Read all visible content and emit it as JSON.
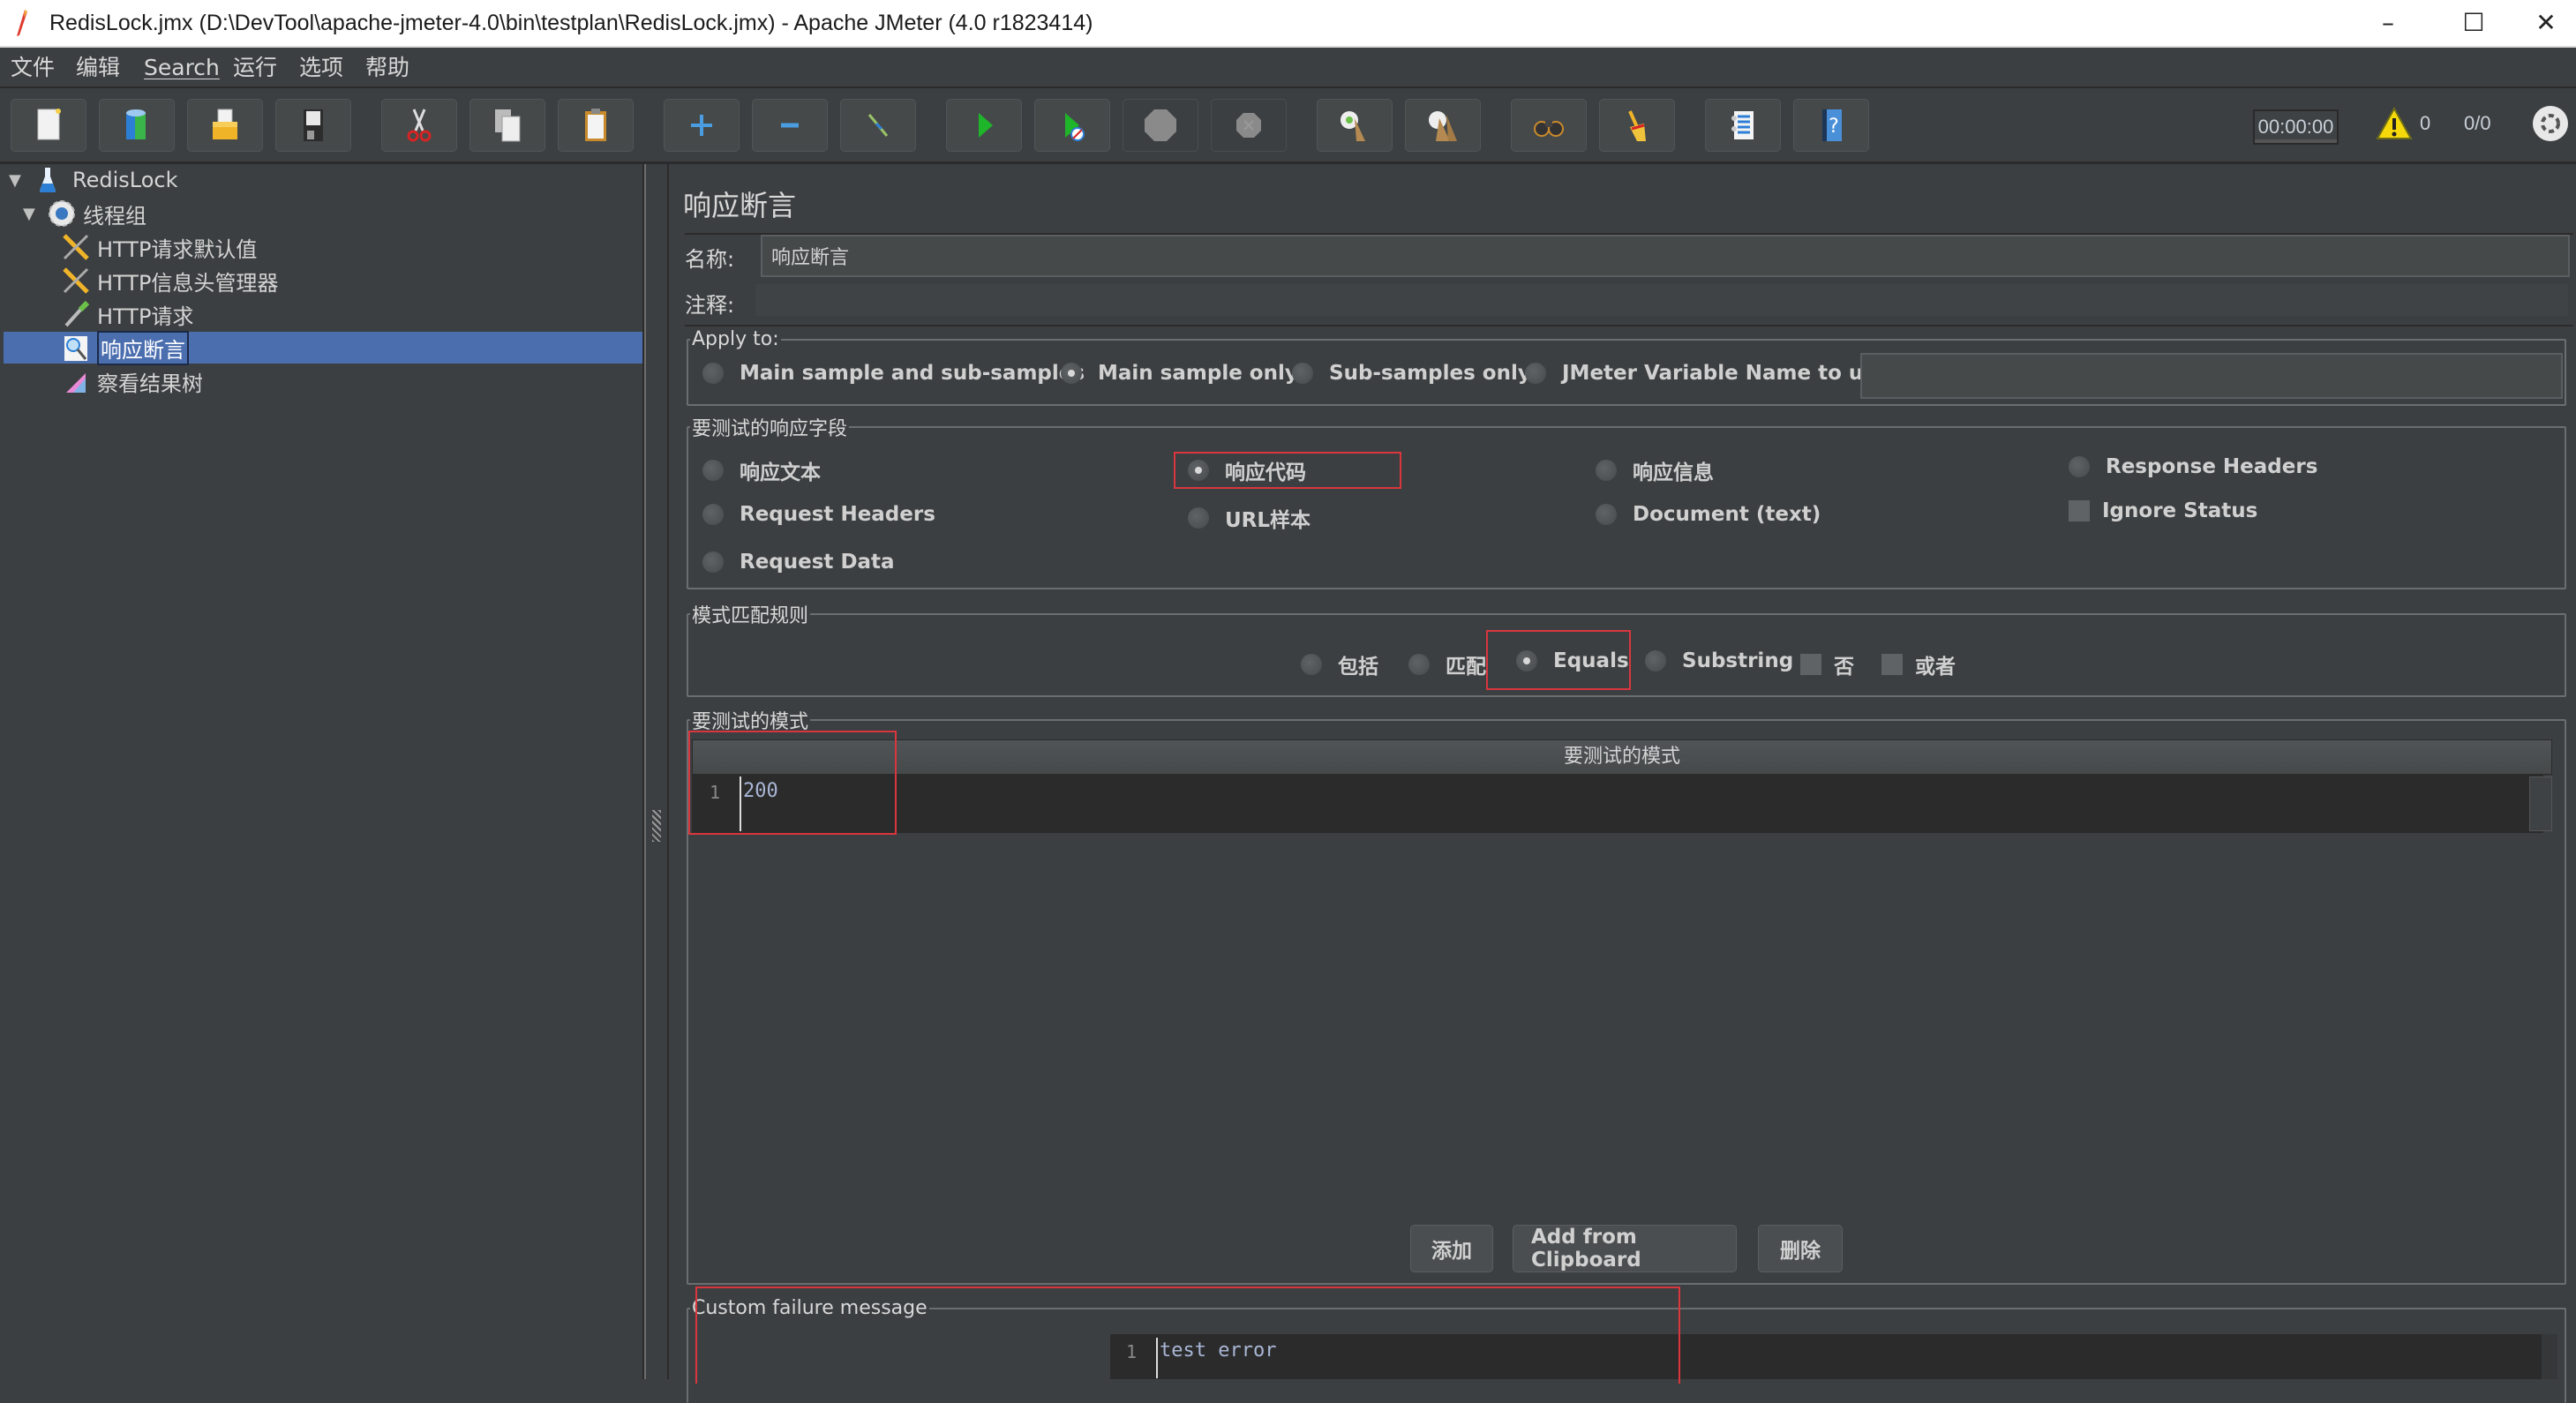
{
  "window": {
    "title": "RedisLock.jmx (D:\\DevTool\\apache-jmeter-4.0\\bin\\testplan\\RedisLock.jmx) - Apache JMeter (4.0 r1823414)",
    "minimize": "–",
    "maximize": "☐",
    "close": "✕"
  },
  "menu": [
    "文件",
    "编辑",
    "Search",
    "运行",
    "选项",
    "帮助"
  ],
  "toolbar": {
    "buttons": [
      {
        "icon": "new-icon"
      },
      {
        "icon": "templates-icon"
      },
      {
        "icon": "open-icon"
      },
      {
        "icon": "save-icon"
      },
      {
        "icon": "cut-icon"
      },
      {
        "icon": "copy-icon"
      },
      {
        "icon": "paste-icon"
      },
      {
        "icon": "expand-icon"
      },
      {
        "icon": "collapse-icon"
      },
      {
        "icon": "toggle-icon"
      },
      {
        "icon": "start-icon"
      },
      {
        "icon": "start-no-pauses-icon"
      },
      {
        "icon": "stop-icon"
      },
      {
        "icon": "shutdown-icon"
      },
      {
        "icon": "clear-icon"
      },
      {
        "icon": "clear-all-icon"
      },
      {
        "icon": "search-icon"
      },
      {
        "icon": "reset-search-icon"
      },
      {
        "icon": "function-helper-icon"
      },
      {
        "icon": "help-icon"
      }
    ],
    "timer": "00:00:00",
    "warning_count": "0",
    "threads": "0/0"
  },
  "tree": {
    "items": [
      {
        "label": "RedisLock",
        "icon": "test-plan-icon",
        "level": 0,
        "expanded": true
      },
      {
        "label": "线程组",
        "icon": "thread-group-icon",
        "level": 1,
        "expanded": true
      },
      {
        "label": "HTTP请求默认值",
        "icon": "config-element-icon",
        "level": 2
      },
      {
        "label": "HTTP信息头管理器",
        "icon": "config-element-icon",
        "level": 2
      },
      {
        "label": "HTTP请求",
        "icon": "sampler-icon",
        "level": 2
      },
      {
        "label": "响应断言",
        "icon": "assertion-icon",
        "level": 2,
        "selected": true
      },
      {
        "label": "察看结果树",
        "icon": "listener-icon",
        "level": 2
      }
    ]
  },
  "panel": {
    "title": "响应断言",
    "name_label": "名称:",
    "name_value": "响应断言",
    "comment_label": "注释:",
    "comment_value": "",
    "apply_to": {
      "legend": "Apply to:",
      "options": [
        "Main sample and sub-samples",
        "Main sample only",
        "Sub-samples only",
        "JMeter Variable Name to use"
      ],
      "selected": "Main sample only",
      "variable_value": ""
    },
    "response_field": {
      "legend": "要测试的响应字段",
      "options": [
        "响应文本",
        "响应代码",
        "响应信息",
        "Response Headers",
        "Request Headers",
        "URL样本",
        "Document (text)",
        "Request Data"
      ],
      "selected": "响应代码",
      "ignore_status_label": "Ignore Status",
      "ignore_status_checked": false
    },
    "pattern_rules": {
      "legend": "模式匹配规则",
      "options": [
        "包括",
        "匹配",
        "Equals",
        "Substring"
      ],
      "selected": "Equals",
      "not_label": "否",
      "not_checked": false,
      "or_label": "或者",
      "or_checked": false
    },
    "patterns": {
      "legend": "要测试的模式",
      "column_header": "要测试的模式",
      "rows": [
        {
          "line": "1",
          "value": "200"
        }
      ],
      "add_label": "添加",
      "add_clipboard_label": "Add from Clipboard",
      "delete_label": "删除"
    },
    "failure": {
      "legend": "Custom failure message",
      "line": "1",
      "value": "test error"
    }
  },
  "colors": {
    "background": "#3c3f41",
    "selection": "#4b6eaf",
    "highlight_box": "#d9363e"
  }
}
